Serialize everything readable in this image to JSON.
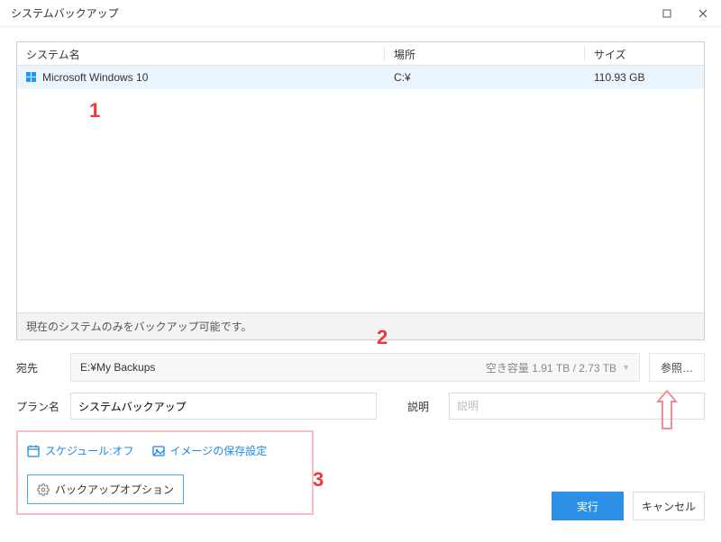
{
  "window": {
    "title": "システムバックアップ"
  },
  "table": {
    "headers": {
      "name": "システム名",
      "location": "場所",
      "size": "サイズ"
    },
    "rows": [
      {
        "name": "Microsoft Windows 10",
        "location": "C:¥",
        "size": "110.93 GB"
      }
    ],
    "footer_note": "現在のシステムのみをバックアップ可能です。"
  },
  "dest": {
    "label": "宛先",
    "path": "E:¥My Backups",
    "free_space": "空き容量 1.91 TB / 2.73 TB",
    "browse_label": "参照…"
  },
  "plan": {
    "label": "プラン名",
    "value": "システムバックアップ"
  },
  "desc": {
    "label": "説明",
    "placeholder": "説明"
  },
  "options": {
    "schedule_label": "スケジュール:オフ",
    "image_retain_label": "イメージの保存設定",
    "backup_options_label": "バックアップオプション"
  },
  "actions": {
    "run": "実行",
    "cancel": "キャンセル"
  },
  "annotations": {
    "a1": "1",
    "a2": "2",
    "a3": "3"
  }
}
